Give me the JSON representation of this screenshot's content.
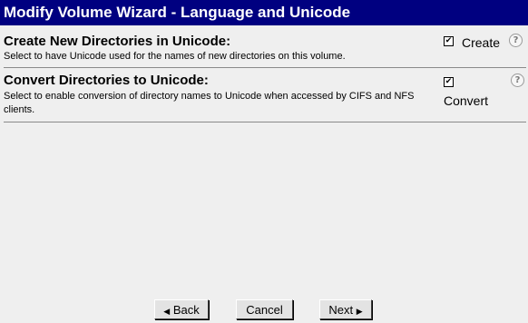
{
  "title": "Modify Volume Wizard - Language and Unicode",
  "sections": [
    {
      "title": "Create New Directories in Unicode:",
      "description": "Select to have Unicode used for the names of new directories on this volume.",
      "checkbox": {
        "checked": true,
        "mark": "✔",
        "label": "Create"
      },
      "help": "?"
    },
    {
      "title": "Convert Directories to Unicode:",
      "description": "Select to enable conversion of directory names to Unicode when accessed by CIFS and NFS clients.",
      "checkbox": {
        "checked": true,
        "mark": "✔",
        "label": "Convert"
      },
      "help": "?"
    }
  ],
  "buttons": {
    "back": "Back",
    "back_arrow": "◀",
    "cancel": "Cancel",
    "next": "Next",
    "next_arrow": "▶"
  },
  "icons": {
    "help": "help-icon",
    "back_arrow": "triangle-left-icon",
    "next_arrow": "triangle-right-icon"
  },
  "colors": {
    "title_bar": "#000080",
    "title_text": "#ffffff",
    "background": "#efefef"
  }
}
